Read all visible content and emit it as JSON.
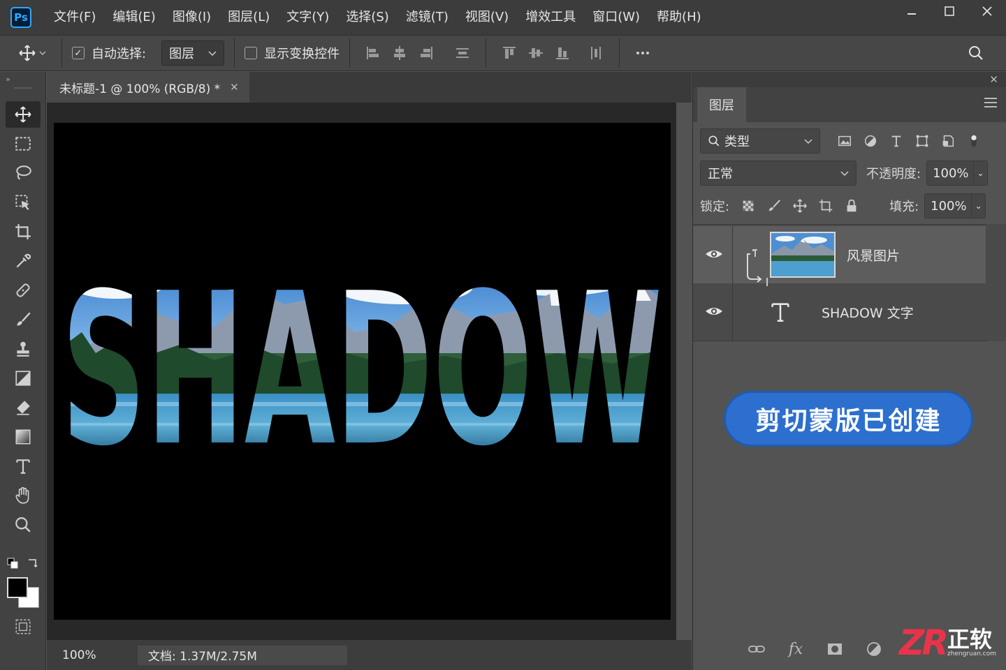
{
  "app": {
    "logo": "Ps"
  },
  "menu": [
    "文件(F)",
    "编辑(E)",
    "图像(I)",
    "图层(L)",
    "文字(Y)",
    "选择(S)",
    "滤镜(T)",
    "视图(V)",
    "增效工具",
    "窗口(W)",
    "帮助(H)"
  ],
  "options": {
    "auto_select_checked": true,
    "auto_select_label": "自动选择:",
    "auto_select_target": "图层",
    "show_transform_label": "显示变换控件",
    "show_transform_checked": false
  },
  "document": {
    "tab_title": "未标题-1 @ 100% (RGB/8) *",
    "canvas_text": "SHADOW",
    "zoom": "100%",
    "doc_size": "文档: 1.37M/2.75M"
  },
  "layers_panel": {
    "tab_label": "图层",
    "filter_label": "类型",
    "blend_mode": "正常",
    "opacity_label": "不透明度:",
    "opacity_value": "100%",
    "lock_label": "锁定:",
    "fill_label": "填充:",
    "fill_value": "100%",
    "layers": [
      {
        "name": "风景图片",
        "type": "image",
        "visible": true,
        "clipped": true,
        "selected": true
      },
      {
        "name": "SHADOW 文字",
        "type": "text",
        "visible": true,
        "clipped": false,
        "selected": false
      }
    ]
  },
  "toast": {
    "text": "剪切蒙版已创建"
  },
  "watermark": {
    "mark": "ZR",
    "brand": "正软",
    "url": "zhengruan.com"
  },
  "colors": {
    "accent": "#2c6fce",
    "brand_mark": "#e8344a",
    "ps_blue": "#31a8ff"
  }
}
